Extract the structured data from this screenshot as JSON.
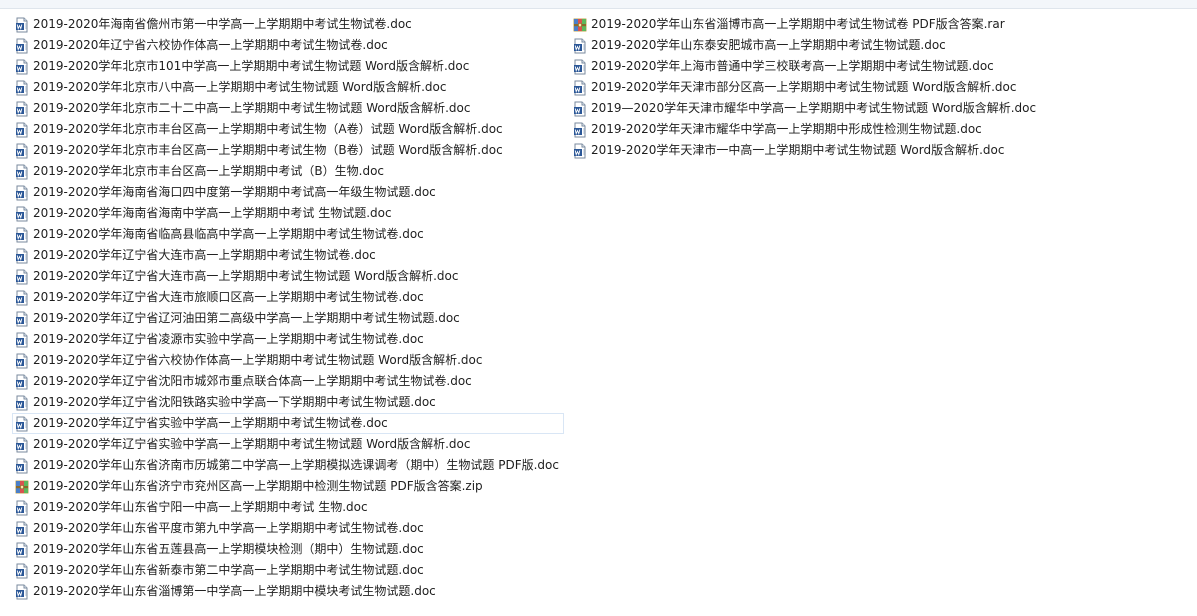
{
  "colors": {
    "doc_icon_blue": "#2b5797",
    "zip_icon_yellow": "#f3c74a"
  },
  "files_left": [
    {
      "name": "2019-2020年海南省儋州市第一中学高一上学期期中考试生物试卷.doc",
      "icon": "word-doc-icon"
    },
    {
      "name": "2019-2020年辽宁省六校协作体高一上学期期中考试生物试卷.doc",
      "icon": "word-doc-icon"
    },
    {
      "name": "2019-2020学年北京市101中学高一上学期期中考试生物试题 Word版含解析.doc",
      "icon": "word-doc-icon"
    },
    {
      "name": "2019-2020学年北京市八中高一上学期期中考试生物试题 Word版含解析.doc",
      "icon": "word-doc-icon"
    },
    {
      "name": "2019-2020学年北京市二十二中高一上学期期中考试生物试题 Word版含解析.doc",
      "icon": "word-doc-icon"
    },
    {
      "name": "2019-2020学年北京市丰台区高一上学期期中考试生物（A卷）试题 Word版含解析.doc",
      "icon": "word-doc-icon"
    },
    {
      "name": "2019-2020学年北京市丰台区高一上学期期中考试生物（B卷）试题 Word版含解析.doc",
      "icon": "word-doc-icon"
    },
    {
      "name": "2019-2020学年北京市丰台区高一上学期期中考试（B）生物.doc",
      "icon": "word-doc-icon"
    },
    {
      "name": "2019-2020学年海南省海口四中度第一学期期中考试高一年级生物试题.doc",
      "icon": "word-doc-icon"
    },
    {
      "name": "2019-2020学年海南省海南中学高一上学期期中考试 生物试题.doc",
      "icon": "word-doc-icon"
    },
    {
      "name": "2019-2020学年海南省临高县临高中学高一上学期期中考试生物试卷.doc",
      "icon": "word-doc-icon"
    },
    {
      "name": "2019-2020学年辽宁省大连市高一上学期期中考试生物试卷.doc",
      "icon": "word-doc-icon"
    },
    {
      "name": "2019-2020学年辽宁省大连市高一上学期期中考试生物试题 Word版含解析.doc",
      "icon": "word-doc-icon"
    },
    {
      "name": "2019-2020学年辽宁省大连市旅顺口区高一上学期期中考试生物试卷.doc",
      "icon": "word-doc-icon"
    },
    {
      "name": "2019-2020学年辽宁省辽河油田第二高级中学高一上学期期中考试生物试题.doc",
      "icon": "word-doc-icon"
    },
    {
      "name": "2019-2020学年辽宁省凌源市实验中学高一上学期期中考试生物试卷.doc",
      "icon": "word-doc-icon"
    },
    {
      "name": "2019-2020学年辽宁省六校协作体高一上学期期中考试生物试题 Word版含解析.doc",
      "icon": "word-doc-icon"
    },
    {
      "name": "2019-2020学年辽宁省沈阳市城郊市重点联合体高一上学期期中考试生物试卷.doc",
      "icon": "word-doc-icon"
    },
    {
      "name": "2019-2020学年辽宁省沈阳铁路实验中学高一下学期期中考试生物试题.doc",
      "icon": "word-doc-icon"
    },
    {
      "name": "2019-2020学年辽宁省实验中学高一上学期期中考试生物试卷.doc",
      "icon": "word-doc-icon",
      "selected": true
    },
    {
      "name": "2019-2020学年辽宁省实验中学高一上学期期中考试生物试题 Word版含解析.doc",
      "icon": "word-doc-icon"
    },
    {
      "name": "2019-2020学年山东省济南市历城第二中学高一上学期模拟选课调考（期中）生物试题 PDF版.doc",
      "icon": "word-doc-icon"
    },
    {
      "name": "2019-2020学年山东省济宁市兖州区高一上学期期中检测生物试题 PDF版含答案.zip",
      "icon": "zip-archive-icon"
    },
    {
      "name": "2019-2020学年山东省宁阳一中高一上学期期中考试  生物.doc",
      "icon": "word-doc-icon"
    },
    {
      "name": "2019-2020学年山东省平度市第九中学高一上学期期中考试生物试卷.doc",
      "icon": "word-doc-icon"
    },
    {
      "name": "2019-2020学年山东省五莲县高一上学期模块检测（期中）生物试题.doc",
      "icon": "word-doc-icon"
    },
    {
      "name": "2019-2020学年山东省新泰市第二中学高一上学期期中考试生物试题.doc",
      "icon": "word-doc-icon"
    },
    {
      "name": "2019-2020学年山东省淄博第一中学高一上学期期中模块考试生物试题.doc",
      "icon": "word-doc-icon"
    }
  ],
  "files_right": [
    {
      "name": "2019-2020学年山东省淄博市高一上学期期中考试生物试卷 PDF版含答案.rar",
      "icon": "rar-archive-icon"
    },
    {
      "name": "2019-2020学年山东泰安肥城市高一上学期期中考试生物试题.doc",
      "icon": "word-doc-icon"
    },
    {
      "name": "2019-2020学年上海市普通中学三校联考高一上学期期中考试生物试题.doc",
      "icon": "word-doc-icon"
    },
    {
      "name": "2019-2020学年天津市部分区高一上学期期中考试生物试题 Word版含解析.doc",
      "icon": "word-doc-icon"
    },
    {
      "name": "2019—2020学年天津市耀华中学高一上学期期中考试生物试题 Word版含解析.doc",
      "icon": "word-doc-icon"
    },
    {
      "name": "2019-2020学年天津市耀华中学高一上学期期中形成性检测生物试题.doc",
      "icon": "word-doc-icon"
    },
    {
      "name": "2019-2020学年天津市一中高一上学期期中考试生物试题 Word版含解析.doc",
      "icon": "word-doc-icon"
    }
  ]
}
